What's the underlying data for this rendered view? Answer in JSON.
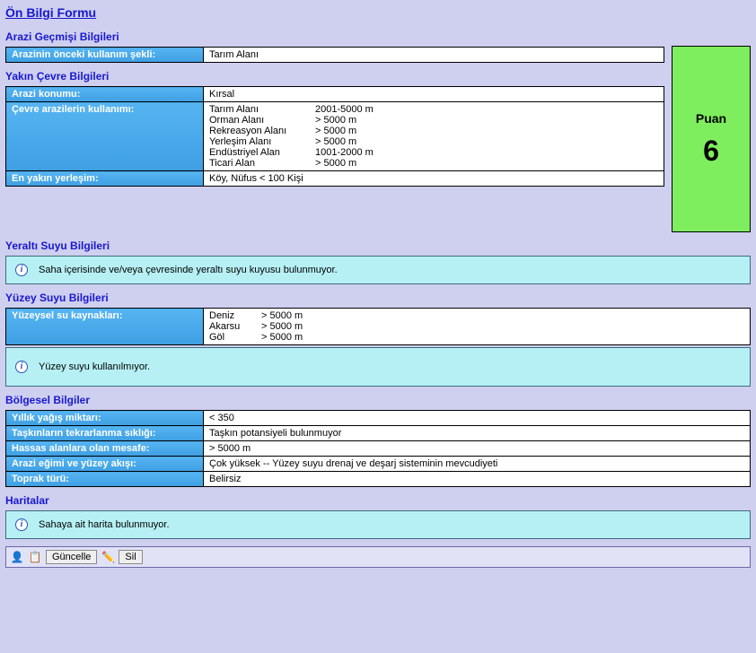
{
  "title": "Ön Bilgi Formu",
  "score": {
    "label": "Puan",
    "value": "6"
  },
  "sections": {
    "history": "Arazi Geçmişi Bilgileri",
    "environment": "Yakın Çevre Bilgileri",
    "groundwater": "Yeraltı Suyu Bilgileri",
    "surfacewater": "Yüzey Suyu Bilgileri",
    "regional": "Bölgesel Bilgiler",
    "maps": "Haritalar"
  },
  "history": {
    "prev_use_label": "Arazinin önceki kullanım şekli:",
    "prev_use_value": "Tarım Alanı"
  },
  "env": {
    "location_label": "Arazi konumu:",
    "location_value": "Kırsal",
    "usage_label": "Çevre arazilerin kullanımı:",
    "usage": [
      {
        "k": "Tarım Alanı",
        "d": "2001-5000 m"
      },
      {
        "k": "Orman Alanı",
        "d": "> 5000 m"
      },
      {
        "k": "Rekreasyon Alanı",
        "d": "> 5000 m"
      },
      {
        "k": "Yerleşim Alanı",
        "d": "> 5000 m"
      },
      {
        "k": "Endüstriyel Alan",
        "d": "1001-2000 m"
      },
      {
        "k": "Ticari Alan",
        "d": "> 5000 m"
      }
    ],
    "settlement_label": "En yakın yerleşim:",
    "settlement_value": "Köy,  Nüfus < 100 Kişi"
  },
  "ground_info": "Saha içerisinde ve/veya çevresinde yeraltı suyu kuyusu bulunmuyor.",
  "surface": {
    "sources_label": "Yüzeysel su kaynakları:",
    "sources": [
      {
        "k": "Deniz",
        "d": "> 5000 m"
      },
      {
        "k": "Akarsu",
        "d": "> 5000 m"
      },
      {
        "k": "Göl",
        "d": "> 5000 m"
      }
    ]
  },
  "surface_info": "Yüzey suyu kullanılmıyor.",
  "regional": {
    "rain_label": "Yıllık yağış miktarı:",
    "rain_value": "< 350",
    "flood_label": "Taşkınların tekrarlanma sıklığı:",
    "flood_value": "Taşkın potansiyeli bulunmuyor",
    "sensitive_label": "Hassas alanlara olan mesafe:",
    "sensitive_value": "> 5000 m",
    "slope_label": "Arazi eğimi ve yüzey akışı:",
    "slope_value": "Çok yüksek -- Yüzey suyu drenaj ve deşarj sisteminin mevcudiyeti",
    "soil_label": "Toprak türü:",
    "soil_value": "Belirsiz"
  },
  "maps_info": "Sahaya ait harita bulunmuyor.",
  "toolbar": {
    "update": "Güncelle",
    "delete": "Sil"
  }
}
